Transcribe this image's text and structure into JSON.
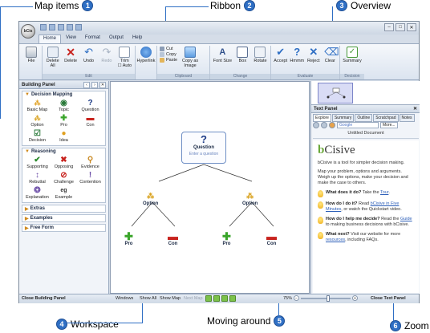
{
  "callouts": {
    "map_items": {
      "label": "Map items",
      "num": "1"
    },
    "ribbon": {
      "label": "Ribbon",
      "num": "2"
    },
    "overview": {
      "label": "Overview",
      "num": "3"
    },
    "workspace": {
      "label": "Workspace",
      "num": "4"
    },
    "moving_around": {
      "label": "Moving around",
      "num": "5"
    },
    "zoom": {
      "label": "Zoom",
      "num": "6"
    }
  },
  "app": {
    "orb_label": "bCis",
    "tabs": [
      "Home",
      "View",
      "Format",
      "Output",
      "Help"
    ],
    "active_tab": "Home"
  },
  "ribbon": {
    "file": "File",
    "delete_all": "Delete All",
    "delete": "Delete",
    "undo": "Undo",
    "redo": "Redo",
    "trim": "Trim",
    "auto": "Auto",
    "hyperlink": "Hyperlink",
    "cut": "Cut",
    "copy": "Copy",
    "paste": "Paste",
    "copy_as_image": "Copy as Image",
    "font_size": "Font Size",
    "box": "Box",
    "rotate": "Rotate",
    "accept": "Accept",
    "hmmm": "Hmmm",
    "reject": "Reject",
    "clear": "Clear",
    "summary": "Summary",
    "groups": {
      "edit": "Edit",
      "clipboard": "Clipboard",
      "change": "Change",
      "evaluate": "Evaluate",
      "decision": "Decision"
    }
  },
  "building_panel": {
    "title": "Building Panel",
    "decision_mapping": {
      "title": "Decision Mapping",
      "items": [
        "Basic Map",
        "Topic",
        "Question",
        "Option",
        "Pro",
        "Con",
        "Decision",
        "Idea"
      ]
    },
    "reasoning": {
      "title": "Reasoning",
      "items": [
        "Supporting",
        "Opposing",
        "Evidence",
        "Rebuttal",
        "Challenge",
        "Contention",
        "Explanation",
        "Example"
      ]
    },
    "extras": "Extras",
    "examples": "Examples",
    "free_form": "Free Form"
  },
  "map": {
    "question_title": "Question",
    "question_prompt": "Enter a question",
    "option": "Option",
    "pro": "Pro",
    "con": "Con"
  },
  "text_panel": {
    "title": "Text Panel",
    "tabs": [
      "Explore",
      "Summary",
      "Outline",
      "Scratchpad",
      "Notes"
    ],
    "active_tab": "Explore",
    "search_placeholder": "Google",
    "more": "More...",
    "doc_title": "Untitled Document",
    "brand_b": "b",
    "brand_rest": "Cisive",
    "intro": "bCisive is a tool for simpler decision making.",
    "intro2": "Map your problem, options and arguments. Weigh up the options, make your decision and make the case to others.",
    "qa": [
      {
        "q": "What does it do?",
        "a": "Take the",
        "link": "Tour",
        "tail": "."
      },
      {
        "q": "How do I do it?",
        "a": "Read",
        "link": "bCisive in Five Minutes",
        "tail": ", or watch the Quickstart video."
      },
      {
        "q": "How do I help me decide?",
        "a": "Read the",
        "link": "Guide",
        "tail": " to making business decisions with bCisive."
      },
      {
        "q": "What next?",
        "a": "Visit our website for more",
        "link": "resources",
        "tail": ", including FAQs."
      }
    ]
  },
  "status": {
    "close_building": "Close Building Panel",
    "windows": "Windows",
    "show_all": "Show All",
    "show_map": "Show Map",
    "next_map": "Next Map",
    "zoom_value": "75%",
    "close_text": "Close Text Panel"
  }
}
